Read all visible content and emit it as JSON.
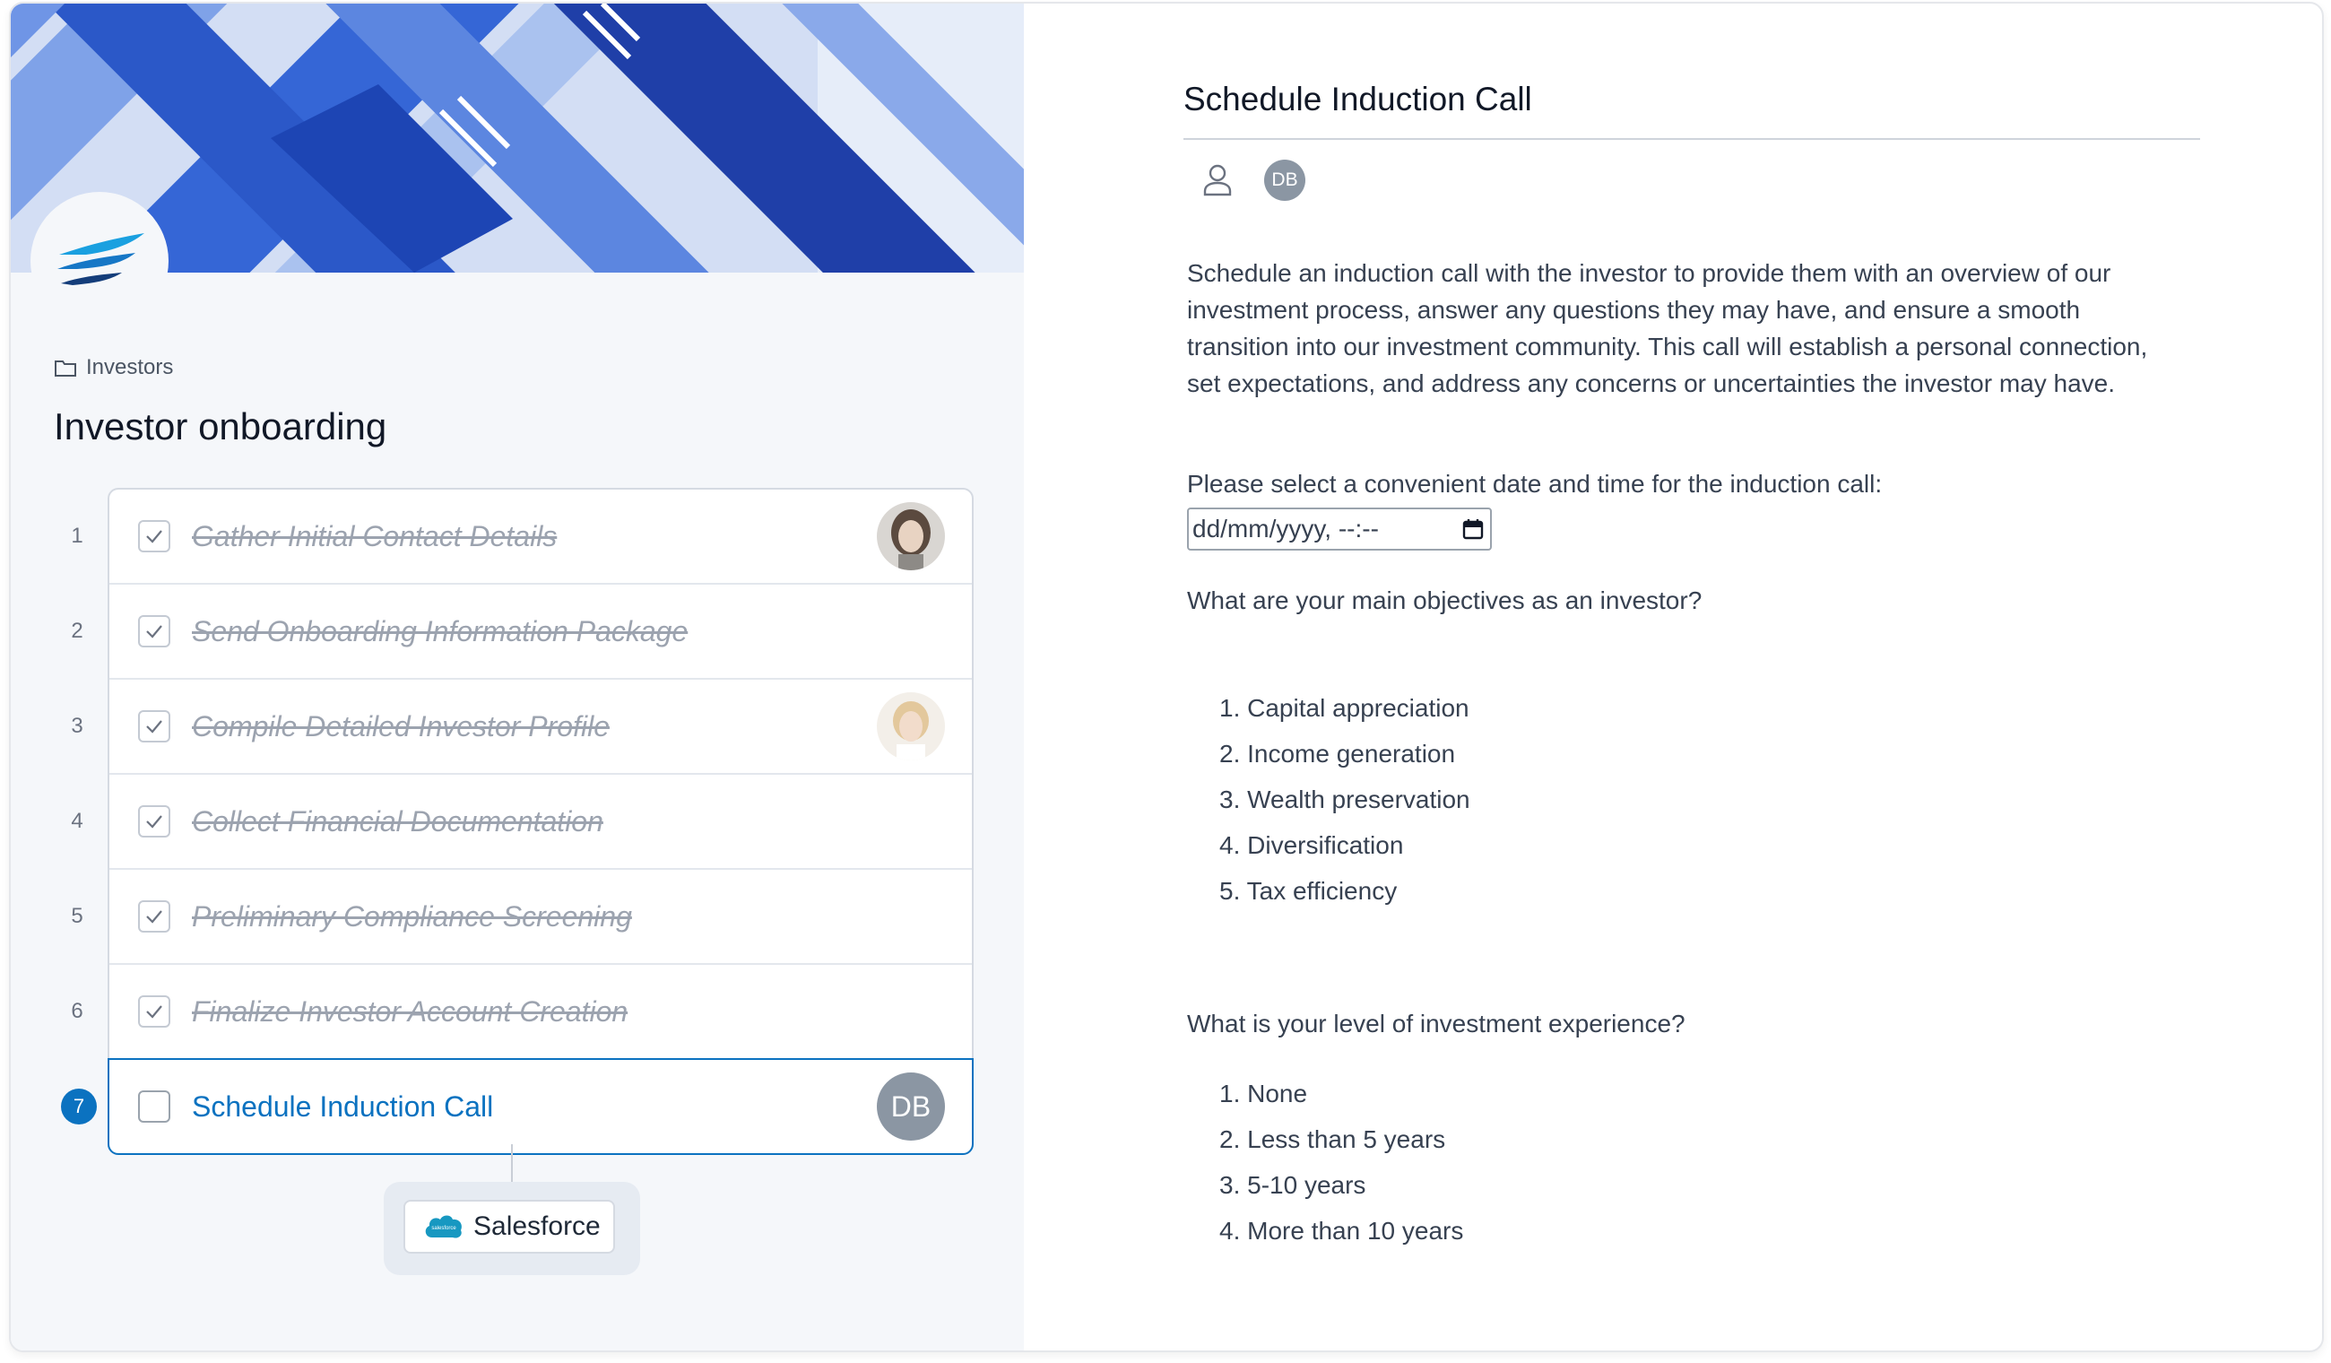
{
  "breadcrumb": {
    "folder_icon": "folder-icon",
    "label": "Investors"
  },
  "page_title": "Investor onboarding",
  "steps": [
    {
      "number": "1",
      "label": "Gather Initial Contact Details",
      "completed": true,
      "assignee": "photo-woman-dark-hair"
    },
    {
      "number": "2",
      "label": "Send Onboarding Information Package",
      "completed": true,
      "assignee": ""
    },
    {
      "number": "3",
      "label": "Compile Detailed Investor Profile",
      "completed": true,
      "assignee": "photo-woman-blonde"
    },
    {
      "number": "4",
      "label": "Collect Financial Documentation",
      "completed": true,
      "assignee": ""
    },
    {
      "number": "5",
      "label": "Preliminary Compliance Screening",
      "completed": true,
      "assignee": ""
    },
    {
      "number": "6",
      "label": "Finalize Investor Account Creation",
      "completed": true,
      "assignee": ""
    },
    {
      "number": "7",
      "label": "Schedule Induction Call",
      "completed": false,
      "active": true,
      "assignee_initials": "DB"
    }
  ],
  "integration": {
    "label": "Salesforce",
    "logo_text": "salesforce"
  },
  "task": {
    "title": "Schedule Induction Call",
    "assignee_initials": "DB",
    "description": "Schedule an induction call with the investor to provide them with an overview of our investment process, answer any questions they may have, and ensure a smooth transition into our investment community. This call will establish a personal connection, set expectations, and address any concerns or uncertainties the investor may have.",
    "date_label": "Please select a convenient date and time for the induction call:",
    "date_placeholder": "dd/mm/yyyy, --:--",
    "objectives_question": "What are your main objectives as an investor?",
    "objectives": [
      "1. Capital appreciation",
      "2. Income generation",
      "3. Wealth preservation",
      "4. Diversification",
      "5. Tax efficiency"
    ],
    "experience_question": "What is your level of investment experience?",
    "experience": [
      "1. None",
      "2. Less than 5 years",
      "3. 5-10 years",
      "4. More than 10 years"
    ]
  },
  "colors": {
    "accent": "#0b72c0",
    "banner_dark": "#1f3fa8",
    "banner_light": "#cfdcf5"
  }
}
